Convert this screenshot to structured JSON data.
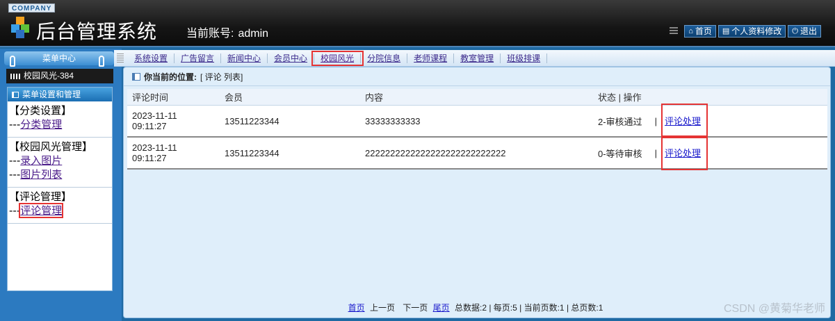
{
  "header": {
    "company": "COMPANY",
    "title": "后台管理系统",
    "account_label": "当前账号:",
    "account_value": "admin",
    "links": [
      {
        "icon": "home-icon",
        "glyph": "⌂",
        "label": "首页"
      },
      {
        "icon": "document-icon",
        "glyph": "▤",
        "label": "个人资料修改"
      },
      {
        "icon": "power-icon",
        "glyph": "⏻",
        "label": "退出"
      }
    ]
  },
  "sidebar": {
    "menu_title": "菜单中心",
    "current_section": "校园风光-384",
    "box_title": "菜单设置和管理",
    "groups": [
      {
        "title": "【分类设置】",
        "items": [
          {
            "prefix": "---",
            "label": "分类管理"
          }
        ]
      },
      {
        "title": "【校园风光管理】",
        "items": [
          {
            "prefix": "---",
            "label": "录入图片"
          },
          {
            "prefix": "---",
            "label": "图片列表"
          }
        ]
      },
      {
        "title": "【评论管理】",
        "items": [
          {
            "prefix": "---",
            "label": "评论管理"
          }
        ]
      }
    ]
  },
  "nav": {
    "items": [
      "系统设置",
      "广告留言",
      "新闻中心",
      "会员中心",
      "校园风光",
      "分院信息",
      "老师课程",
      "教室管理",
      "班级排课"
    ]
  },
  "location": {
    "label": "你当前的位置:",
    "value": "[ 评论 列表]"
  },
  "table": {
    "headers": [
      "评论时间",
      "会员",
      "内容",
      "状态 | 操作"
    ],
    "rows": [
      {
        "time": "2023-11-11 09:11:27",
        "member": "13511223344",
        "content": "33333333333",
        "status": "2-审核通过",
        "sep": "|",
        "action": "评论处理"
      },
      {
        "time": "2023-11-11 09:11:27",
        "member": "13511223344",
        "content": "2222222222222222222222222222",
        "status": "0-等待审核",
        "sep": "|",
        "action": "评论处理"
      }
    ]
  },
  "pager": {
    "first": "首页",
    "prev": "上一页",
    "next": "下一页",
    "last": "尾页",
    "summary": "总数据:2 | 每页:5 | 当前页数:1 | 总页数:1"
  },
  "watermark": "CSDN @黄菊华老师"
}
